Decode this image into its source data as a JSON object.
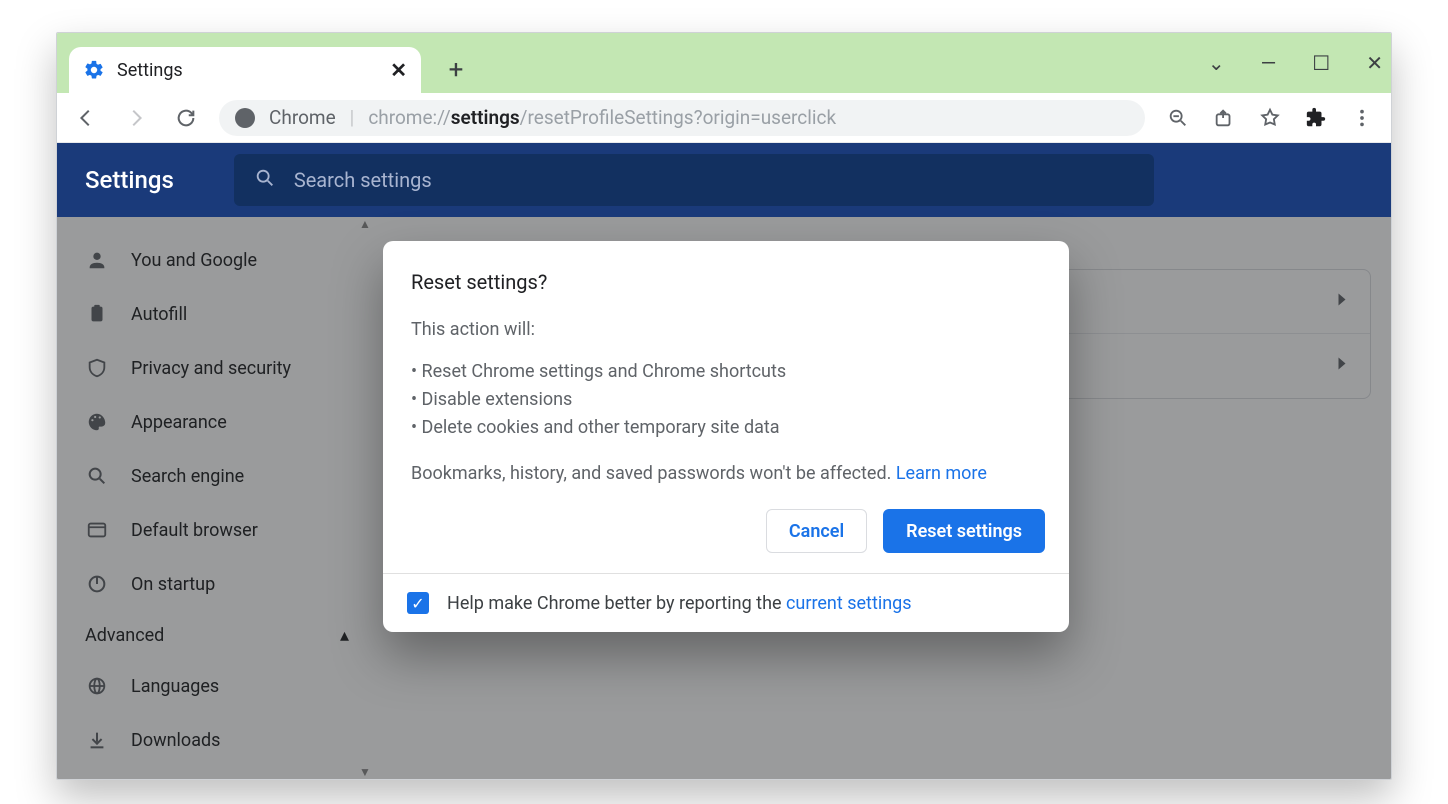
{
  "tab": {
    "title": "Settings"
  },
  "omnibox": {
    "host": "Chrome",
    "url_prefix": "chrome://",
    "url_bold": "settings",
    "url_rest": "/resetProfileSettings?origin=userclick"
  },
  "settings_header": {
    "title": "Settings",
    "search_placeholder": "Search settings"
  },
  "sidebar": {
    "items": [
      {
        "label": "You and Google"
      },
      {
        "label": "Autofill"
      },
      {
        "label": "Privacy and security"
      },
      {
        "label": "Appearance"
      },
      {
        "label": "Search engine"
      },
      {
        "label": "Default browser"
      },
      {
        "label": "On startup"
      }
    ],
    "advanced_label": "Advanced",
    "advanced_items": [
      {
        "label": "Languages"
      },
      {
        "label": "Downloads"
      }
    ]
  },
  "dialog": {
    "title": "Reset settings?",
    "intro": "This action will:",
    "bullets": [
      "Reset Chrome settings and Chrome shortcuts",
      "Disable extensions",
      "Delete cookies and other temporary site data"
    ],
    "note_prefix": "Bookmarks, history, and saved passwords won't be affected. ",
    "learn_more": "Learn more",
    "cancel": "Cancel",
    "confirm": "Reset settings",
    "footer_prefix": "Help make Chrome better by reporting the ",
    "footer_link": "current settings",
    "checkbox_checked": true
  }
}
